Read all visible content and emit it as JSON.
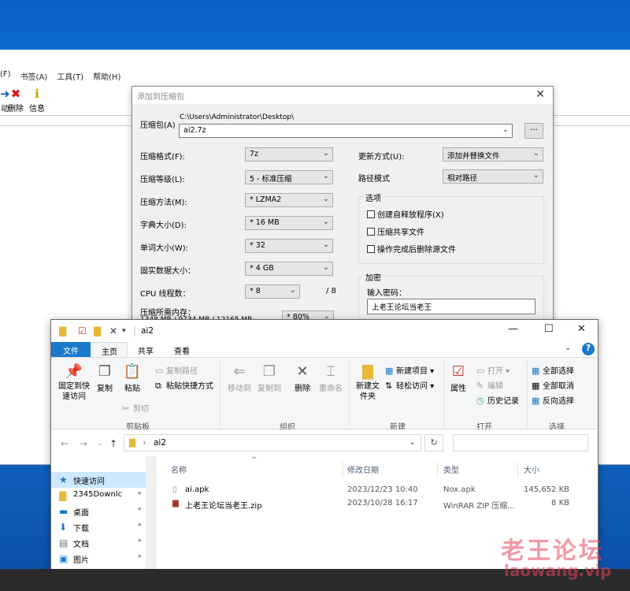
{
  "bg_window": {
    "menu": [
      "(F)",
      "书签(A)",
      "工具(T)",
      "帮助(H)"
    ],
    "toolbar": [
      "动",
      "删除",
      "信息"
    ]
  },
  "dialog": {
    "title": "添加到压缩包",
    "archive_label": "压缩包(A)",
    "archive_path": "C:\\Users\\Administrator\\Desktop\\",
    "archive_name": "ai2.7z",
    "browse_label": "...",
    "format_label": "压缩格式(F):",
    "format_value": "7z",
    "level_label": "压缩等级(L):",
    "level_value": "5 - 标准压缩",
    "method_label": "压缩方法(M):",
    "method_value": "* LZMA2",
    "dict_label": "字典大小(D):",
    "dict_value": "* 16 MB",
    "word_label": "单词大小(W):",
    "word_value": "* 32",
    "solid_label": "固实数据大小：",
    "solid_value": "* 4 GB",
    "cpu_label": "CPU 线程数：",
    "cpu_value": "* 8",
    "cpu_total": "/ 8",
    "mem_label": "压缩所需内存：",
    "mem_value": "1348 MB / 9734 MB / 12165 MB",
    "mem_pct": "* 80%",
    "update_label": "更新方式(U):",
    "update_value": "添加并替换文件",
    "path_label": "路径模式",
    "path_value": "相对路径",
    "options_title": "选项",
    "opt_sfx": "创建自释放程序(X)",
    "opt_shared": "压缩共享文件",
    "opt_delete": "操作完成后删除源文件",
    "enc_title": "加密",
    "pwd_label": "输入密码：",
    "pwd_value": "上老王论坛当老王"
  },
  "explorer": {
    "folder": "ai2",
    "tabs": [
      "文件",
      "主页",
      "共享",
      "查看"
    ],
    "ribbon": {
      "pin": "固定到快速访问",
      "copy": "复制",
      "paste": "粘贴",
      "copy_path": "复制路径",
      "paste_shortcut": "粘贴快捷方式",
      "cut": "剪切",
      "clipboard_group": "剪贴板",
      "move_to": "移动到",
      "copy_to": "复制到",
      "delete": "删除",
      "rename": "重命名",
      "organize_group": "组织",
      "new_folder": "新建文件夹",
      "new_item": "新建项目",
      "easy_access": "轻松访问",
      "new_group": "新建",
      "properties": "属性",
      "open": "打开",
      "edit": "编辑",
      "history": "历史记录",
      "open_group": "打开",
      "select_all": "全部选择",
      "select_none": "全部取消",
      "invert": "反向选择",
      "select_group": "选择"
    },
    "address": "ai2",
    "nav": [
      {
        "label": "快速访问"
      },
      {
        "label": "2345Downlc"
      },
      {
        "label": "桌面"
      },
      {
        "label": "下载"
      },
      {
        "label": "文档"
      },
      {
        "label": "图片"
      }
    ],
    "columns": [
      "名称",
      "修改日期",
      "类型",
      "大小"
    ],
    "files": [
      {
        "name": "ai.apk",
        "date": "2023/12/23 10:40",
        "type": "Nox.apk",
        "size": "145,652 KB"
      },
      {
        "name": "上老王论坛当老王.zip",
        "date": "2023/10/28 16:17",
        "type": "WinRAR ZIP 压缩...",
        "size": "8 KB"
      }
    ]
  },
  "watermark": {
    "cn": "老王论坛",
    "url": "laowang.vip"
  },
  "colors": {
    "accent": "#1979ca",
    "desktop": "#0a63c7"
  }
}
